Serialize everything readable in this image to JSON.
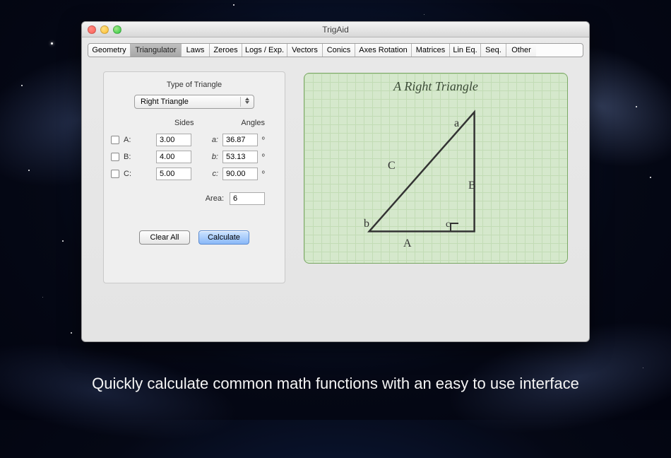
{
  "window": {
    "title": "TrigAid"
  },
  "tabs": [
    "Geometry",
    "Triangulator",
    "Laws",
    "Zeroes",
    "Logs / Exp.",
    "Vectors",
    "Conics",
    "Axes Rotation",
    "Matrices",
    "Lin Eq.",
    "Seq.",
    "Other"
  ],
  "active_tab_index": 1,
  "panel": {
    "heading": "Type of Triangle",
    "select_value": "Right Triangle",
    "col_sides": "Sides",
    "col_angles": "Angles",
    "rows": [
      {
        "side_label": "A:",
        "side_value": "3.00",
        "angle_label": "a:",
        "angle_value": "36.87"
      },
      {
        "side_label": "B:",
        "side_value": "4.00",
        "angle_label": "b:",
        "angle_value": "53.13"
      },
      {
        "side_label": "C:",
        "side_value": "5.00",
        "angle_label": "c:",
        "angle_value": "90.00"
      }
    ],
    "degree": "º",
    "area_label": "Area:",
    "area_value": "6",
    "clear_label": "Clear All",
    "calc_label": "Calculate"
  },
  "diagram": {
    "title": "A Right Triangle",
    "labels": {
      "a": "a",
      "b": "b",
      "c": "c",
      "A": "A",
      "B": "B",
      "C": "C"
    }
  },
  "caption": "Quickly calculate common math functions with an easy to use interface"
}
